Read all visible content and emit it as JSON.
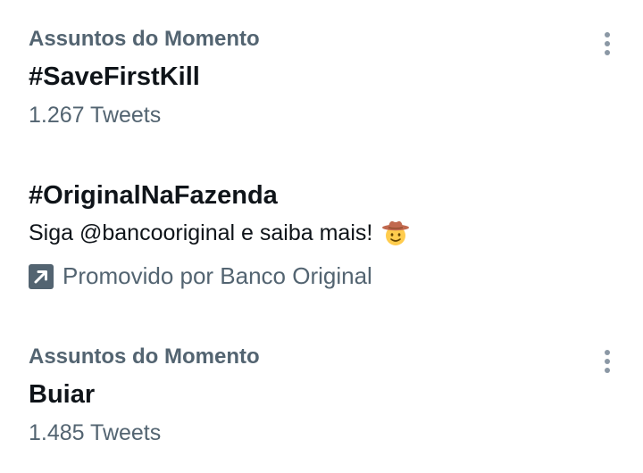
{
  "trends": [
    {
      "category": "Assuntos do Momento",
      "title": "#SaveFirstKill",
      "count": "1.267 Tweets",
      "more_icon": "more-vertical-icon"
    },
    {
      "title": "#OriginalNaFazenda",
      "description": "Siga @bancooriginal e saiba mais!",
      "emoji": "cowboy-hat-face-emoji",
      "promoted": "Promovido por Banco Original",
      "promoted_icon": "arrow-up-right-icon"
    },
    {
      "category": "Assuntos do Momento",
      "title": "Buiar",
      "count": "1.485 Tweets",
      "more_icon": "more-vertical-icon"
    }
  ],
  "colors": {
    "primary_text": "#0f1419",
    "secondary_text": "#536471",
    "promo_icon_bg": "#536471"
  }
}
